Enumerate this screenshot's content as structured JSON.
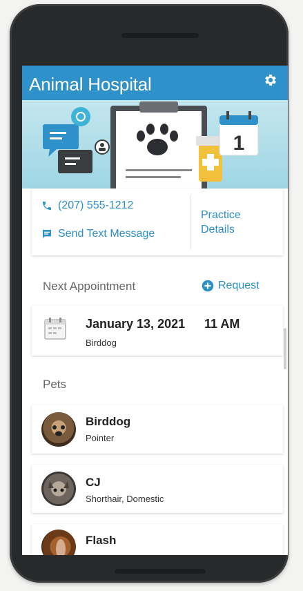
{
  "app": {
    "title": "Animal Hospital"
  },
  "colors": {
    "brand": "#2f91c9",
    "link": "#2d8fc6"
  },
  "contact": {
    "phone": "(207) 555-1212",
    "text_message": "Send Text Message",
    "practice_details": "Practice Details"
  },
  "appointment": {
    "section_label": "Next Appointment",
    "request_label": "Request",
    "date": "January 13, 2021",
    "time": "11 AM",
    "pet": "Birddog"
  },
  "pets": {
    "section_label": "Pets",
    "items": [
      {
        "name": "Birddog",
        "breed": "Pointer"
      },
      {
        "name": "CJ",
        "breed": "Shorthair, Domestic"
      },
      {
        "name": "Flash",
        "breed": ""
      }
    ]
  }
}
